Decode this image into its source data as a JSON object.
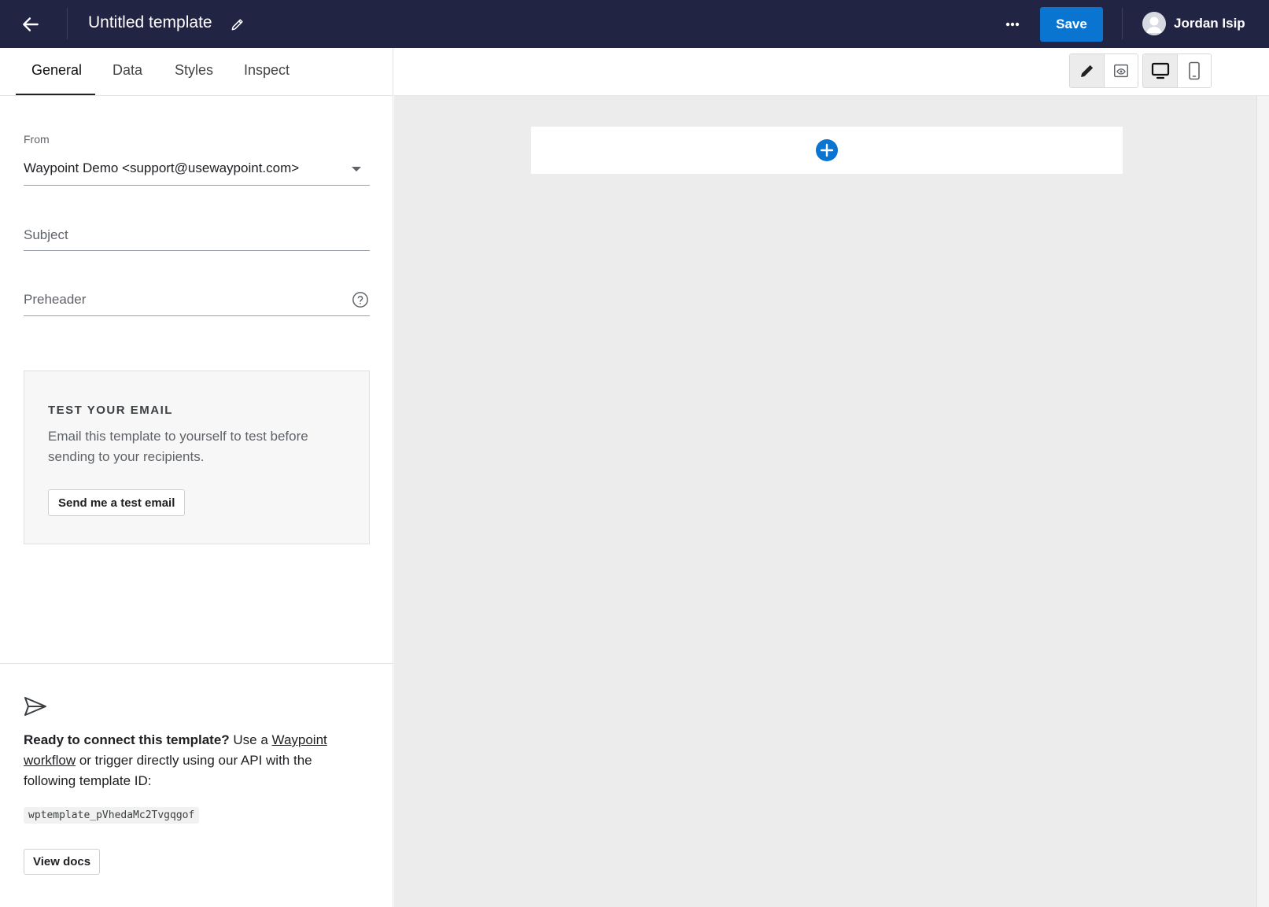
{
  "header": {
    "title": "Untitled template",
    "save_label": "Save",
    "user_name": "Jordan Isip",
    "brand_color": "#222444",
    "accent_color": "#0a74d1"
  },
  "tabs": [
    {
      "label": "General",
      "active": true
    },
    {
      "label": "Data",
      "active": false
    },
    {
      "label": "Styles",
      "active": false
    },
    {
      "label": "Inspect",
      "active": false
    }
  ],
  "form": {
    "from_label": "From",
    "from_value": "Waypoint Demo <support@usewaypoint.com>",
    "subject_placeholder": "Subject",
    "preheader_placeholder": "Preheader"
  },
  "test_email": {
    "heading": "TEST YOUR EMAIL",
    "description": "Email this template to yourself to test before sending to your recipients.",
    "button_label": "Send me a test email"
  },
  "connect": {
    "lead_bold": "Ready to connect this template?",
    "text_1": " Use a ",
    "link_1": "Waypoint",
    "link_2": "workflow",
    "text_2": " or trigger directly using our API with the following template ID:",
    "template_id": "wptemplate_pVhedaMc2Tvgqgof",
    "docs_button": "View docs"
  },
  "toolbar": {
    "mode_active": "edit",
    "device_active": "desktop"
  },
  "icons": {
    "back": "arrow-left-icon",
    "title_edit": "pencil-icon",
    "more": "more-horizontal-icon",
    "avatar": "user-avatar-icon",
    "help": "help-circle-icon",
    "send": "send-icon",
    "edit_mode": "pencil-icon",
    "preview_mode": "eye-window-icon",
    "desktop": "monitor-icon",
    "mobile": "phone-icon",
    "add_block": "plus-circle-icon"
  }
}
